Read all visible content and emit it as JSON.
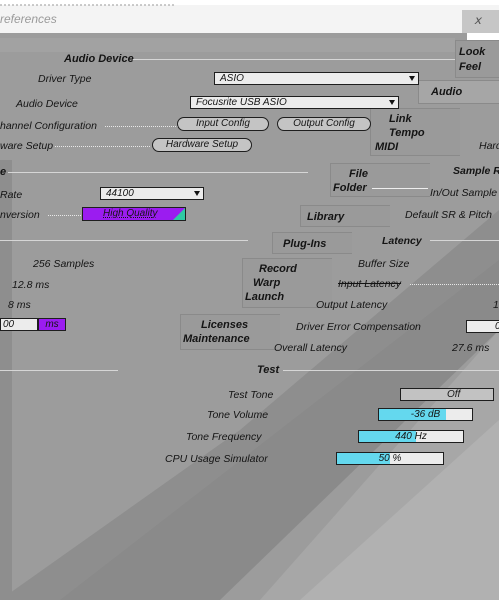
{
  "window": {
    "title": "references"
  },
  "tabs": {
    "look_feel": [
      "Look",
      "Feel"
    ],
    "audio": "Audio",
    "link_tempo_midi": [
      "Link",
      "Tempo",
      "MIDI"
    ],
    "file_folder": [
      "File",
      "Folder"
    ],
    "library": "Library",
    "plug_ins": "Plug-Ins",
    "record_warp_launch": [
      "Record",
      "Warp",
      "Launch"
    ],
    "licenses_maintenance": [
      "Licenses",
      "Maintenance"
    ]
  },
  "audio_device": {
    "header": "Audio Device",
    "driver_type_label": "Driver Type",
    "driver_type_value": "ASIO",
    "audio_device_label": "Audio Device",
    "audio_device_value": "Focusrite USB ASIO",
    "channel_config_label": "hannel Configuration",
    "input_config_button": "Input Config",
    "output_config_button": "Output Config",
    "hardware_setup_label": "ware Setup",
    "hardware_setup_button": "Hardware Setup"
  },
  "sample_rate": {
    "header": "e",
    "rate_label": "Rate",
    "rate_value": "44100",
    "conversion_label": "nversion",
    "conversion_value": "High Quality"
  },
  "latency_left": {
    "buffer_value": "256 Samples",
    "input_latency_value": "12.8 ms",
    "output_latency_value": "8 ms",
    "compensation_value": "00",
    "compensation_unit": "ms"
  },
  "right_partial": {
    "hard": "Hard",
    "sample_rate": "Sample R",
    "in_out_sample": "In/Out Sample",
    "default_sr": "Default SR & Pitch",
    "latency_header": "Latency",
    "buffer_size": "Buffer Size",
    "input_latency": "Input Latency",
    "output_latency": "Output Latency",
    "output_latency_value": "1",
    "driver_error": "Driver Error Compensation",
    "driver_error_value": "0",
    "overall_latency": "Overall Latency",
    "overall_latency_value": "27.6 ms"
  },
  "test": {
    "header": "Test",
    "tone_label": "Test Tone",
    "tone_value": "Off",
    "volume_label": "Tone Volume",
    "volume_value": "-36 dB",
    "volume_fill": 0.72,
    "frequency_label": "Tone Frequency",
    "frequency_value": "440 Hz",
    "frequency_fill": 0.55,
    "cpu_label": "CPU Usage Simulator",
    "cpu_value": "50 %",
    "cpu_fill": 0.5
  },
  "colors": {
    "panel": "#9e9e9e",
    "panel_dark": "#8c8c8c",
    "accent_purple": "#9b1cf0",
    "accent_cyan": "#64d8ee",
    "teal": "#2fc9a3"
  }
}
